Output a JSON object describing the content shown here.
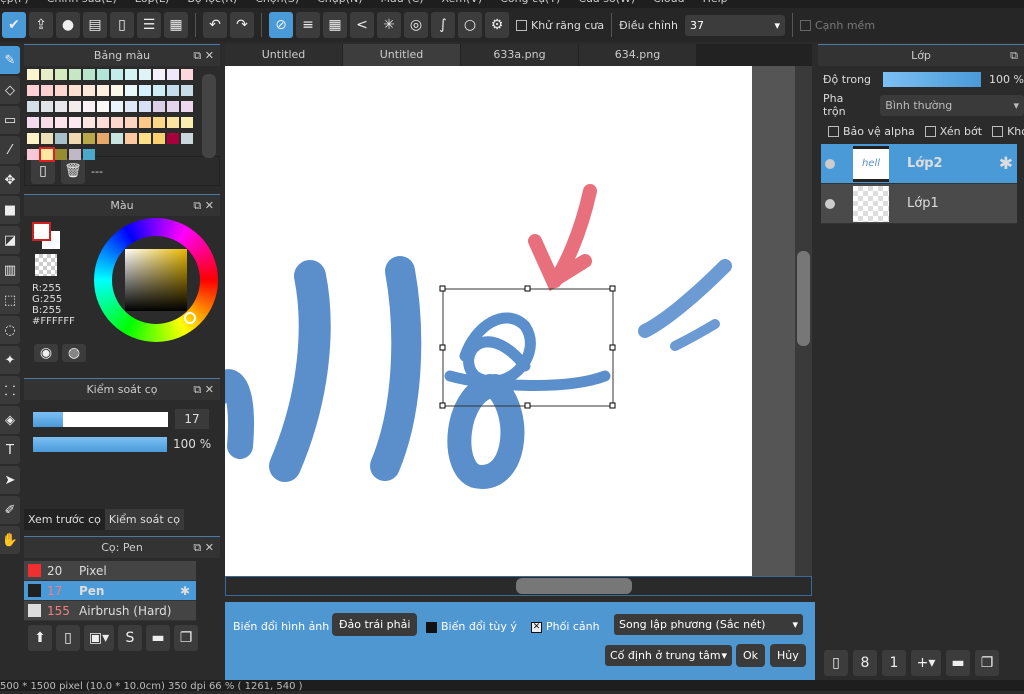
{
  "menu": [
    "ệp(F)",
    "Chỉnh sửa(E)",
    "Lớp(L)",
    "Bộ lọc(R)",
    "Chọn(S)",
    "Chụp(N)",
    "Màu (C)",
    "Xem(V)",
    "Công cụ(T)",
    "Cửa sổ(W)",
    "Cloud",
    "Help"
  ],
  "toolbar": {
    "antialias": "Khử răng cưa",
    "adjust": "Điều chỉnh",
    "adjust_value": "37",
    "soft_edge": "Cạnh mềm"
  },
  "palette": {
    "title": "Bảng màu",
    "name": "---",
    "colors": [
      "#fdf5d0",
      "#e6f0c8",
      "#d4ecc0",
      "#c6e6c4",
      "#b8e4cc",
      "#b4e4d8",
      "#c4ecec",
      "#d4f4f4",
      "#e0f4f8",
      "#f4f0fc",
      "#f0e8f8",
      "#fcd8dc",
      "#fcd0d4",
      "#fcd0d0",
      "#fcd8d0",
      "#fce0d0",
      "#fce8d8",
      "#fcf0e0",
      "#fcf8e8",
      "#e8f8fc",
      "#d8f0fc",
      "#cceef4",
      "#c4dcec",
      "#c8dce8",
      "#d4e0e8",
      "#e0e4e8",
      "#e8e8ec",
      "#f4ecec",
      "#f8f0f4",
      "#fcf8f8",
      "#ecf4fc",
      "#e0e8f8",
      "#d8e0f4",
      "#dcd0e8",
      "#e4d4ec",
      "#ecd8ec",
      "#f0dcec",
      "#f8dce8",
      "#fce4ec",
      "#fce8f0",
      "#fce4e0",
      "#fcdcd8",
      "#fcd8cc",
      "#fcd4c0",
      "#fcc888",
      "#fcd888",
      "#fce4a0",
      "#fcf0b0",
      "#fcf4c8",
      "#ece0b8",
      "#a8c0c8",
      "#f0d8b0",
      "#b8a848",
      "#e8a868",
      "#c8e4e0",
      "#fcc8a0",
      "#fce088",
      "#f8d070",
      "#a8003c",
      "#c8d8dc",
      "#f8c8d8",
      "#fce8a0",
      "#988c30",
      "#c0b8c8",
      "#4aa8c8"
    ],
    "selected_index": 61
  },
  "color": {
    "title": "Màu",
    "r": "R:255",
    "g": "G:255",
    "b": "B:255",
    "hex": "#FFFFFF"
  },
  "brush_control": {
    "title": "Kiểm soát cọ",
    "size": "17",
    "size_fraction": 0.22,
    "opacity": "100 %",
    "opacity_fraction": 1.0
  },
  "left_tabs": [
    "Xem trước cọ",
    "Kiểm soát cọ"
  ],
  "brushes": {
    "title": "Cọ: Pen",
    "items": [
      {
        "size": "20",
        "name": "Pixel",
        "color": "#f03030"
      },
      {
        "size": "17",
        "name": "Pen",
        "color": "#202020",
        "selected": true
      },
      {
        "size": "155",
        "name": "Airbrush (Hard)",
        "color": "#dddddd"
      }
    ]
  },
  "tabs": [
    "Untitled",
    "Untitled",
    "633a.png",
    "634.png"
  ],
  "active_tab": 1,
  "layers": {
    "title": "Lớp",
    "opacity_label": "Độ trong",
    "opacity_value": "100 %",
    "blend_label": "Pha trộn",
    "blend_value": "Bình thường",
    "protect_alpha": "Bảo vệ alpha",
    "clipping": "Xén bớt",
    "lock": "Khóa",
    "items": [
      {
        "name": "Lớp2",
        "selected": true
      },
      {
        "name": "Lớp1"
      }
    ]
  },
  "transform": {
    "label": "Biến đổi hình ảnh",
    "flip": "Đảo trái phải",
    "free": "Biến đổi tùy ý",
    "perspective": "Phối cảnh",
    "free_checked": false,
    "perspective_checked": true,
    "interp": "Song lập phương (Sắc nét)",
    "anchor": "Cố định ở trung tâm",
    "ok": "Ok",
    "cancel": "Hủy"
  },
  "status": "500 * 1500 pixel   (10.0 * 10.0cm)   350 dpi   66 %   ( 1261, 540 )",
  "colors": {
    "accent": "#4a9ad8",
    "bar": "#4f97d1",
    "stroke": "#5b8fcb",
    "arrow": "#e8707c"
  }
}
